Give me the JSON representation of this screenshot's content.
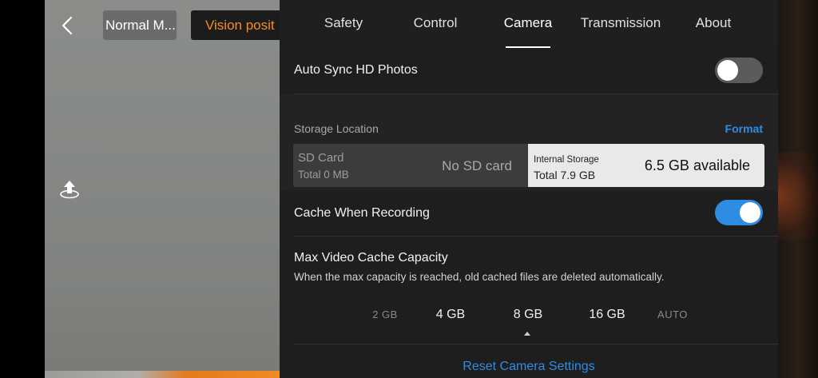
{
  "camera_view": {
    "flight_mode_label": "Normal M...",
    "vision_label": "Vision posit",
    "back_icon": "chevron-left-icon",
    "upload_icon": "upload-icon"
  },
  "tabs": [
    {
      "label": "Safety",
      "active": false
    },
    {
      "label": "Control",
      "active": false
    },
    {
      "label": "Camera",
      "active": true
    },
    {
      "label": "Transmission",
      "active": false
    },
    {
      "label": "About",
      "active": false
    }
  ],
  "auto_sync": {
    "label": "Auto Sync HD Photos",
    "enabled": false
  },
  "storage": {
    "section_label": "Storage Location",
    "format_label": "Format",
    "sd_card": {
      "name": "SD Card",
      "total": "Total 0 MB",
      "status": "No SD card"
    },
    "internal": {
      "name": "Internal Storage",
      "total": "Total 7.9 GB",
      "available": "6.5 GB available",
      "selected": true
    }
  },
  "cache_recording": {
    "label": "Cache When Recording",
    "enabled": true
  },
  "max_cache": {
    "title": "Max Video Cache Capacity",
    "description": "When the max capacity is reached, old cached files are deleted automatically.",
    "options": [
      "2 GB",
      "4 GB",
      "8 GB",
      "16 GB",
      "AUTO"
    ],
    "selected": "8 GB"
  },
  "reset_label": "Reset Camera Settings",
  "colors": {
    "accent": "#2f8ce3",
    "vision_text": "#f58a2c",
    "panel_bg": "#1e1e1e"
  }
}
